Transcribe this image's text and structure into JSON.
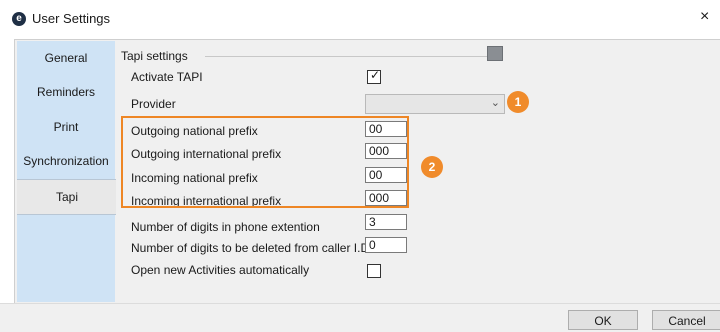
{
  "window": {
    "title": "User Settings",
    "app_icon_letter": "e",
    "close_glyph": "×"
  },
  "sidebar": {
    "items": [
      {
        "label": "General"
      },
      {
        "label": "Reminders"
      },
      {
        "label": "Print"
      },
      {
        "label": "Synchronization"
      },
      {
        "label": "Tapi",
        "selected": true
      }
    ]
  },
  "panel": {
    "group_title": "Tapi settings",
    "group_icon": "screen-icon",
    "activate_tapi": {
      "label": "Activate TAPI",
      "checked": true
    },
    "provider": {
      "label": "Provider",
      "value": ""
    },
    "outgoing_national_prefix": {
      "label": "Outgoing national prefix",
      "value": "00"
    },
    "outgoing_international_prefix": {
      "label": "Outgoing international prefix",
      "value": "000"
    },
    "incoming_national_prefix": {
      "label": "Incoming national prefix",
      "value": "00"
    },
    "incoming_international_prefix": {
      "label": "Incoming international prefix",
      "value": "000"
    },
    "digits_extension": {
      "label": "Number of digits in phone extention",
      "value": "3"
    },
    "digits_deleted": {
      "label": "Number of digits to be deleted from caller I.D.",
      "value": "0"
    },
    "open_new_activities": {
      "label": "Open new Activities automatically",
      "checked": false
    }
  },
  "annotations": {
    "badge1": "1",
    "badge2": "2",
    "accent_color": "#f08b2b"
  },
  "footer": {
    "ok_label": "OK",
    "cancel_label": "Cancel"
  }
}
